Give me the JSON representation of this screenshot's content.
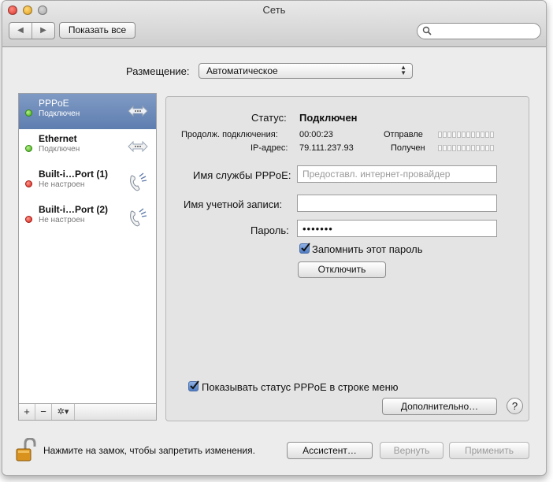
{
  "window": {
    "title": "Сеть"
  },
  "toolbar": {
    "back_glyph": "◀",
    "forward_glyph": "▶",
    "show_all_label": "Показать все",
    "search_value": ""
  },
  "location": {
    "label": "Размещение:",
    "value": "Автоматическое"
  },
  "services": [
    {
      "name": "PPPoE",
      "status": "Подключен",
      "status_color": "green",
      "icon": "ethernet-arrows-icon",
      "selected": true
    },
    {
      "name": "Ethernet",
      "status": "Подключен",
      "status_color": "green",
      "icon": "ethernet-arrows-icon",
      "selected": false
    },
    {
      "name": "Built-i…Port (1)",
      "status": "Не настроен",
      "status_color": "red",
      "icon": "phone-modem-icon",
      "selected": false
    },
    {
      "name": "Built-i…Port (2)",
      "status": "Не настроен",
      "status_color": "red",
      "icon": "phone-modem-icon",
      "selected": false
    }
  ],
  "sidebar_actions": {
    "add": "+",
    "remove": "−",
    "gear": "✲▾"
  },
  "details": {
    "status_label": "Статус:",
    "status_value": "Подключен",
    "duration_label": "Продолж. подключения:",
    "duration_value": "00:00:23",
    "ip_label": "IP-адрес:",
    "ip_value": "79.111.237.93",
    "sent_label": "Отправле",
    "received_label": "Получен",
    "service_name_label": "Имя службы PPPoE:",
    "service_name_placeholder": "Предоставл. интернет-провайдер",
    "account_label": "Имя учетной записи:",
    "account_value": "",
    "password_label": "Пароль:",
    "password_value": "•••••••",
    "remember_label": "Запомнить этот пароль",
    "remember_checked": true,
    "disconnect_label": "Отключить",
    "show_status_label": "Показывать статус PPPoE в строке меню",
    "show_status_checked": true,
    "advanced_label": "Дополнительно…",
    "help_label": "?"
  },
  "footer": {
    "lock_text": "Нажмите на замок, чтобы запретить изменения.",
    "assistant_label": "Ассистент…",
    "revert_label": "Вернуть",
    "apply_label": "Применить"
  },
  "colors": {
    "selection": "#6f8cbc",
    "accent_check": "#4f7cc2",
    "status_green": "#3ea513",
    "status_red": "#d2221a"
  }
}
